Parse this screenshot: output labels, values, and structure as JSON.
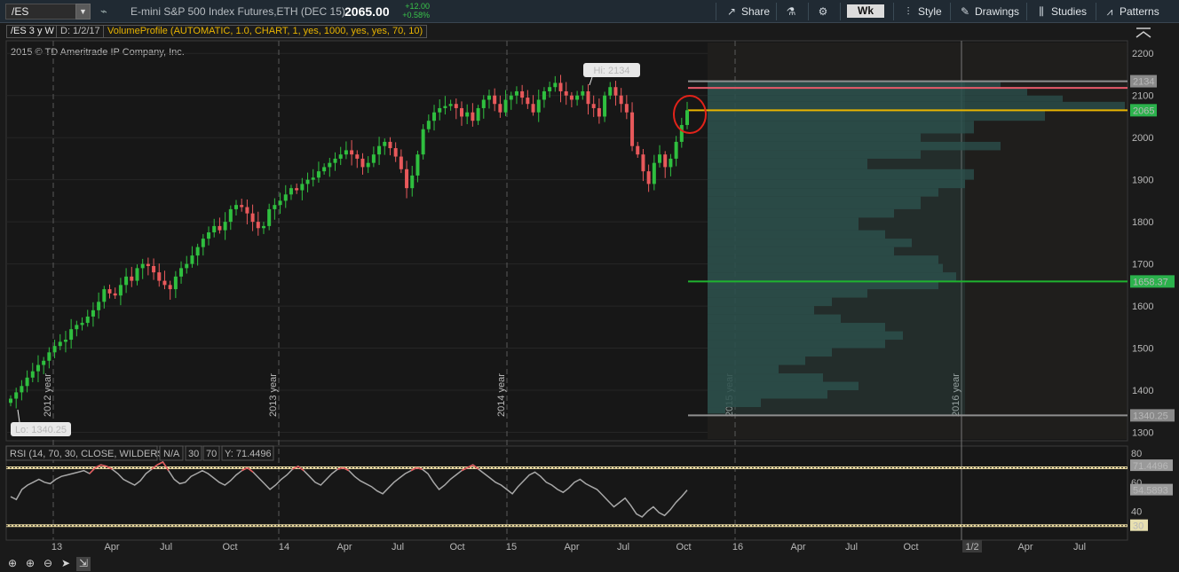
{
  "toolbar": {
    "symbol": "/ES",
    "description": "E-mini S&P 500 Index Futures,ETH (DEC 15)",
    "last_price": "2065.00",
    "change": "+12.00",
    "change_pct": "+0.58%",
    "buttons": [
      {
        "name": "share-button",
        "icon": "share-icon",
        "label": "Share"
      },
      {
        "name": "flask-button",
        "icon": "flask-icon",
        "label": ""
      },
      {
        "name": "gear-button",
        "icon": "gear-icon",
        "label": ""
      },
      {
        "name": "style-button",
        "icon": "style-icon",
        "label": "Style"
      },
      {
        "name": "drawings-button",
        "icon": "pencil-icon",
        "label": "Drawings"
      },
      {
        "name": "studies-button",
        "icon": "studies-icon",
        "label": "Studies"
      },
      {
        "name": "patterns-button",
        "icon": "patterns-icon",
        "label": "Patterns"
      }
    ],
    "period": "Wk"
  },
  "infobar": {
    "chart_label": "/ES 3 y W",
    "date_label": "D: 1/2/17",
    "study_label": "VolumeProfile (AUTOMATIC, 1.0, CHART, 1, yes, 1000, yes, yes, 70, 10)"
  },
  "copyright": "2015 © TD Ameritrade IP Company, Inc.",
  "price_panel": {
    "hi_label": "Hi: 2134",
    "lo_label": "Lo: 1340.25",
    "y_ticks": [
      "2200",
      "2100",
      "2000",
      "1900",
      "1800",
      "1700",
      "1600",
      "1500",
      "1400",
      "1300"
    ],
    "price_badges": [
      {
        "value": "2134",
        "color": "#8a8a8a"
      },
      {
        "value": "2065",
        "color": "#2bb24c"
      },
      {
        "value": "1658.37",
        "color": "#2bb24c"
      },
      {
        "value": "1340.25",
        "color": "#8a8a8a"
      }
    ],
    "year_markers": [
      "2012 year",
      "2013 year",
      "2014 year",
      "2015 year",
      "2016 year"
    ]
  },
  "rsi_panel": {
    "label": "RSI (14, 70, 30, CLOSE, WILDERS)",
    "na": "N/A",
    "level_low": "30",
    "level_high": "70",
    "y_readout": "Y: 71.4496",
    "y_ticks": [
      "80",
      "60",
      "40"
    ],
    "badges": [
      {
        "value": "71.4496",
        "color": "#9a9a9a"
      },
      {
        "value": "54.5893",
        "color": "#9a9a9a"
      },
      {
        "value": "30",
        "color": "#e8e0b0"
      }
    ]
  },
  "x_axis": {
    "labels": [
      "13",
      "Apr",
      "Jul",
      "Oct",
      "14",
      "Apr",
      "Jul",
      "Oct",
      "15",
      "Apr",
      "Jul",
      "Oct",
      "16",
      "Apr",
      "Jul",
      "Oct",
      "1/2",
      "Apr",
      "Jul"
    ]
  },
  "colors": {
    "up": "#2fbf3f",
    "down": "#e8595b",
    "poc": "#e8b400",
    "va_high": "#e85a6a",
    "va_low": "#1fb32f",
    "profile": "#2a4a48"
  },
  "chart_data": {
    "type": "candlestick",
    "title": "/ES 3 y W",
    "ylim": [
      1280,
      2230
    ],
    "weekly_close_approx": [
      1380,
      1395,
      1410,
      1430,
      1445,
      1460,
      1470,
      1490,
      1505,
      1515,
      1520,
      1545,
      1555,
      1560,
      1575,
      1590,
      1610,
      1640,
      1630,
      1625,
      1650,
      1670,
      1660,
      1690,
      1700,
      1695,
      1680,
      1660,
      1650,
      1640,
      1670,
      1690,
      1700,
      1720,
      1740,
      1760,
      1775,
      1790,
      1780,
      1800,
      1830,
      1840,
      1835,
      1820,
      1800,
      1785,
      1790,
      1830,
      1840,
      1850,
      1865,
      1880,
      1875,
      1890,
      1900,
      1905,
      1920,
      1930,
      1940,
      1950,
      1960,
      1970,
      1960,
      1950,
      1930,
      1940,
      1960,
      1980,
      1990,
      1975,
      1955,
      1925,
      1880,
      1910,
      1960,
      2020,
      2040,
      2060,
      2070,
      2075,
      2080,
      2070,
      2050,
      2060,
      2040,
      2070,
      2090,
      2100,
      2080,
      2060,
      2090,
      2100,
      2110,
      2095,
      2080,
      2060,
      2090,
      2110,
      2120,
      2130,
      2110,
      2100,
      2090,
      2100,
      2110,
      2080,
      2070,
      2050,
      2100,
      2120,
      2100,
      2080,
      2060,
      1980,
      1960,
      1920,
      1890,
      1940,
      1960,
      1930,
      1950,
      1990,
      2030,
      2065
    ],
    "value_area_high": 2118,
    "point_of_control": 2065,
    "value_area_low": 1658.37,
    "rsi": {
      "ylim": [
        20,
        85
      ],
      "levels": [
        70,
        30
      ],
      "values": [
        50,
        48,
        55,
        58,
        60,
        62,
        60,
        59,
        62,
        64,
        65,
        66,
        67,
        68,
        66,
        70,
        72,
        71,
        69,
        66,
        62,
        60,
        58,
        61,
        66,
        69,
        72,
        74,
        68,
        62,
        59,
        60,
        64,
        66,
        68,
        66,
        63,
        60,
        58,
        61,
        65,
        68,
        70,
        67,
        63,
        59,
        55,
        58,
        62,
        65,
        69,
        71,
        68,
        64,
        60,
        58,
        62,
        66,
        69,
        70,
        68,
        64,
        61,
        59,
        57,
        54,
        52,
        56,
        60,
        63,
        66,
        68,
        70,
        69,
        66,
        60,
        55,
        58,
        62,
        65,
        68,
        70,
        72,
        69,
        66,
        63,
        60,
        58,
        55,
        52,
        57,
        61,
        65,
        67,
        64,
        60,
        58,
        55,
        53,
        56,
        60,
        62,
        59,
        57,
        55,
        51,
        47,
        43,
        46,
        49,
        44,
        38,
        36,
        40,
        43,
        39,
        37,
        41,
        46,
        50,
        54.5893
      ]
    }
  }
}
